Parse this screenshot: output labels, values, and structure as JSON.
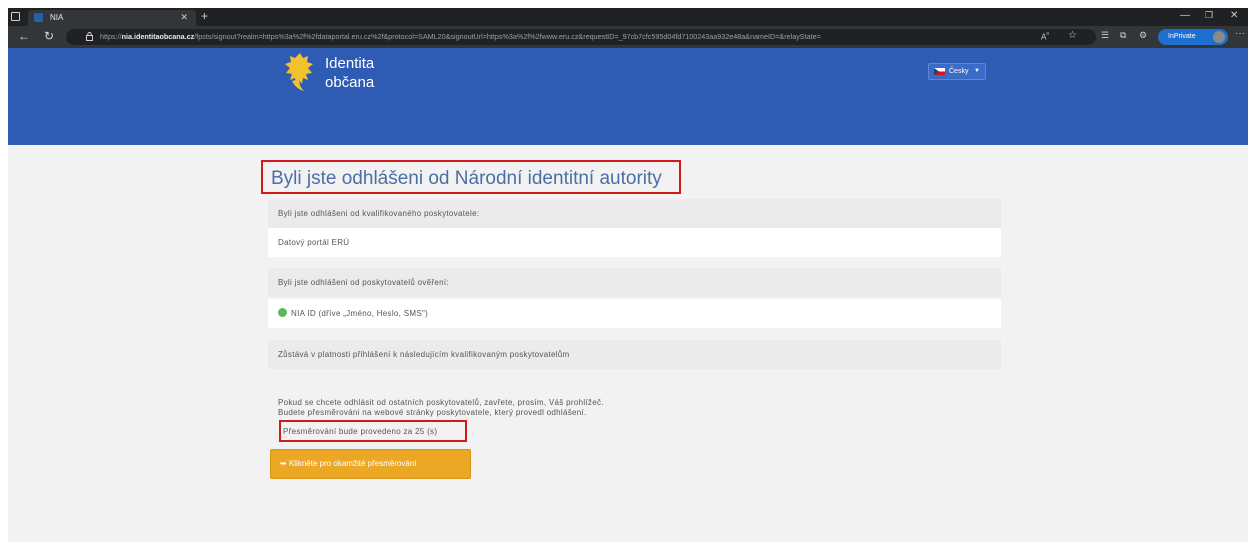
{
  "browser": {
    "tab_title": "NIA",
    "url_prefix": "https://",
    "url_domain": "nia.identitaobcana.cz",
    "url_rest": "/fpsts/signout?realm=https%3a%2f%2fdataportal.eru.cz%2f&protocol=SAML20&signoutUrl=https%3a%2f%2fwww.eru.cz&requestID=_97cb7cfc595d04fd7100243aa932e48a&nameID=&relayState=",
    "inprivate_label": "InPrivate"
  },
  "header": {
    "logo_line1": "Identita",
    "logo_line2": "občana",
    "language": "Česky"
  },
  "main": {
    "heading": "Byli jste odhlášeni od Národní identitní autority",
    "qualified_provider_label": "Byli jste odhlášeni od kvalifikovaného poskytovatele:",
    "qualified_provider_name": "Datový portál ERÚ",
    "auth_provider_label": "Byli jste odhlášeni od poskytovatelů ověření:",
    "auth_provider_name": "NIA ID (dříve „Jméno, Heslo, SMS\")",
    "remaining_label": "Zůstává v platnosti přihlášení k následujícím kvalifikovaným poskytovatelům",
    "info_line1": "Pokud se chcete odhlásit od ostatních poskytovatelů, zavřete, prosím, Váš prohlížeč.",
    "info_line2": "Budete přesměrováni na webové stránky poskytovatele, který provedl odhlášení.",
    "redirect_countdown": "Přesměrování bude provedeno za 25 (s)",
    "redirect_button": "Klikněte pro okamžité přesměrování"
  }
}
